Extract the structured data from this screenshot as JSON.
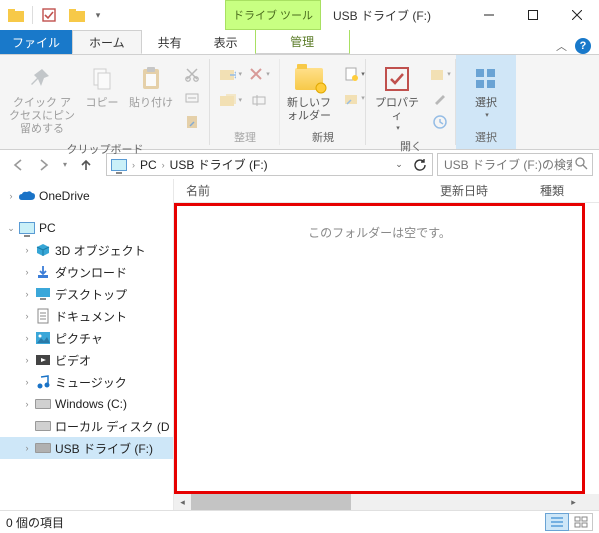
{
  "title": "USB ドライブ (F:)",
  "contextual_tab": "ドライブ ツール",
  "tabs": {
    "file": "ファイル",
    "home": "ホーム",
    "share": "共有",
    "view": "表示",
    "manage": "管理"
  },
  "ribbon": {
    "clipboard": {
      "label": "クリップボード",
      "pin": "クイック アクセスにピン留めする",
      "copy": "コピー",
      "paste": "貼り付け"
    },
    "organize": {
      "label": "整理"
    },
    "new": {
      "label": "新規",
      "new_folder": "新しいフォルダー"
    },
    "open": {
      "label": "開く",
      "properties": "プロパティ"
    },
    "select": {
      "label": "選択",
      "select_btn": "選択"
    }
  },
  "breadcrumb": {
    "pc": "PC",
    "current": "USB ドライブ (F:)"
  },
  "search_placeholder": "USB ドライブ (F:)の検索",
  "sidebar": {
    "onedrive": "OneDrive",
    "pc": "PC",
    "items": [
      "3D オブジェクト",
      "ダウンロード",
      "デスクトップ",
      "ドキュメント",
      "ピクチャ",
      "ビデオ",
      "ミュージック",
      "Windows (C:)",
      "ローカル ディスク (D",
      "USB ドライブ (F:)"
    ]
  },
  "columns": {
    "name": "名前",
    "date": "更新日時",
    "type": "種類"
  },
  "empty_text": "このフォルダーは空です。",
  "status": "0 個の項目"
}
